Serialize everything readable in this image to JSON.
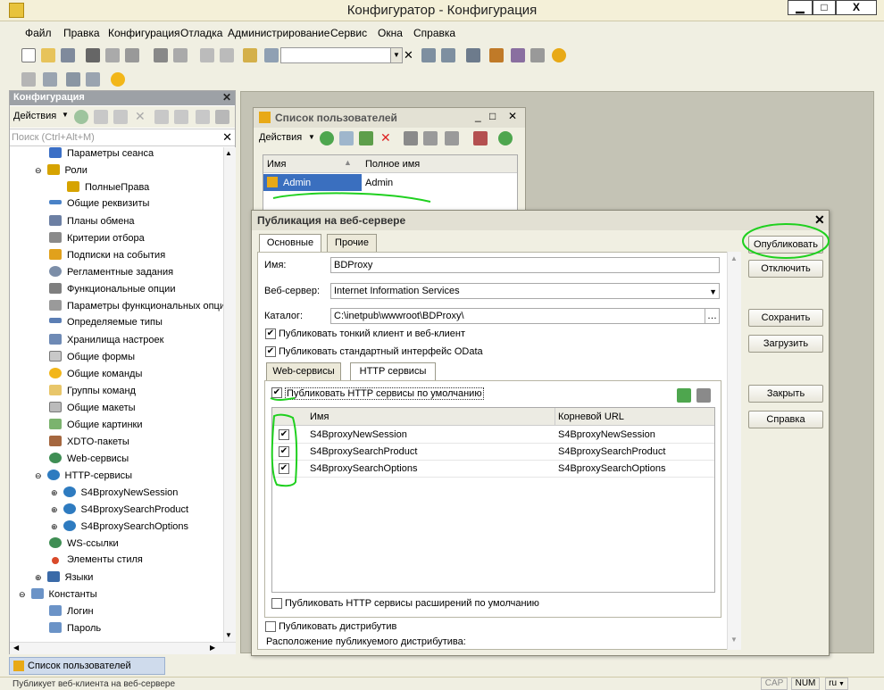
{
  "window": {
    "title": "Конфигуратор - Конфигурация",
    "min": "▁",
    "max": "□",
    "close": "X"
  },
  "menu": [
    "Файл",
    "Правка",
    "Конфигурация",
    "Отладка",
    "Администрирование",
    "Сервис",
    "Окна",
    "Справка"
  ],
  "config_panel": {
    "title": "Конфигурация",
    "actions_label": "Действия",
    "search_placeholder": "Поиск (Ctrl+Alt+M)",
    "items": [
      {
        "label": "Параметры сеанса"
      },
      {
        "label": "Роли"
      },
      {
        "label": "ПолныеПрава"
      },
      {
        "label": "Общие реквизиты"
      },
      {
        "label": "Планы обмена"
      },
      {
        "label": "Критерии отбора"
      },
      {
        "label": "Подписки на события"
      },
      {
        "label": "Регламентные задания"
      },
      {
        "label": "Функциональные опции"
      },
      {
        "label": "Параметры функциональных опци"
      },
      {
        "label": "Определяемые типы"
      },
      {
        "label": "Хранилища настроек"
      },
      {
        "label": "Общие формы"
      },
      {
        "label": "Общие команды"
      },
      {
        "label": "Группы команд"
      },
      {
        "label": "Общие макеты"
      },
      {
        "label": "Общие картинки"
      },
      {
        "label": "XDTO-пакеты"
      },
      {
        "label": "Web-сервисы"
      },
      {
        "label": "HTTP-сервисы"
      },
      {
        "label": "S4BproxyNewSession"
      },
      {
        "label": "S4BproxySearchProduct"
      },
      {
        "label": "S4BproxySearchOptions"
      },
      {
        "label": "WS-ссылки"
      },
      {
        "label": "Элементы стиля"
      },
      {
        "label": "Языки"
      },
      {
        "label": "Константы"
      },
      {
        "label": "Логин"
      },
      {
        "label": "Пароль"
      }
    ]
  },
  "users_window": {
    "title": "Список пользователей",
    "actions_label": "Действия",
    "col_name": "Имя",
    "col_fullname": "Полное имя",
    "rows": [
      {
        "name": "Admin",
        "fullname": "Admin"
      }
    ]
  },
  "publish_dialog": {
    "title": "Публикация на веб-сервере",
    "tab_main": "Основные",
    "tab_other": "Прочие",
    "name_label": "Имя:",
    "name_value": "BDProxy",
    "server_label": "Веб-сервер:",
    "server_value": "Internet Information Services",
    "catalog_label": "Каталог:",
    "catalog_value": "C:\\inetpub\\wwwroot\\BDProxy\\",
    "cb_thin_client": "Публиковать тонкий клиент и веб-клиент",
    "cb_odata": "Публиковать стандартный интерфейс OData",
    "subtab_web": "Web-сервисы",
    "subtab_http": "HTTP сервисы",
    "cb_http_default": "Публиковать HTTP сервисы по умолчанию",
    "col_name": "Имя",
    "col_root": "Корневой URL",
    "services": [
      {
        "name": "S4BproxyNewSession",
        "url": "S4BproxyNewSession"
      },
      {
        "name": "S4BproxySearchProduct",
        "url": "S4BproxySearchProduct"
      },
      {
        "name": "S4BproxySearchOptions",
        "url": "S4BproxySearchOptions"
      }
    ],
    "cb_http_ext": "Публиковать HTTP сервисы расширений по умолчанию",
    "cb_distrib": "Публиковать дистрибутив",
    "distrib_location": "Расположение публикуемого дистрибутива:",
    "btn_publish": "Опубликовать",
    "btn_disable": "Отключить",
    "btn_save": "Сохранить",
    "btn_load": "Загрузить",
    "btn_close": "Закрыть",
    "btn_help": "Справка"
  },
  "taskbar": {
    "item": "Список пользователей"
  },
  "status": {
    "text": "Публикует веб-клиента на веб-сервере",
    "cap": "CAP",
    "num": "NUM",
    "lang": "ru"
  }
}
